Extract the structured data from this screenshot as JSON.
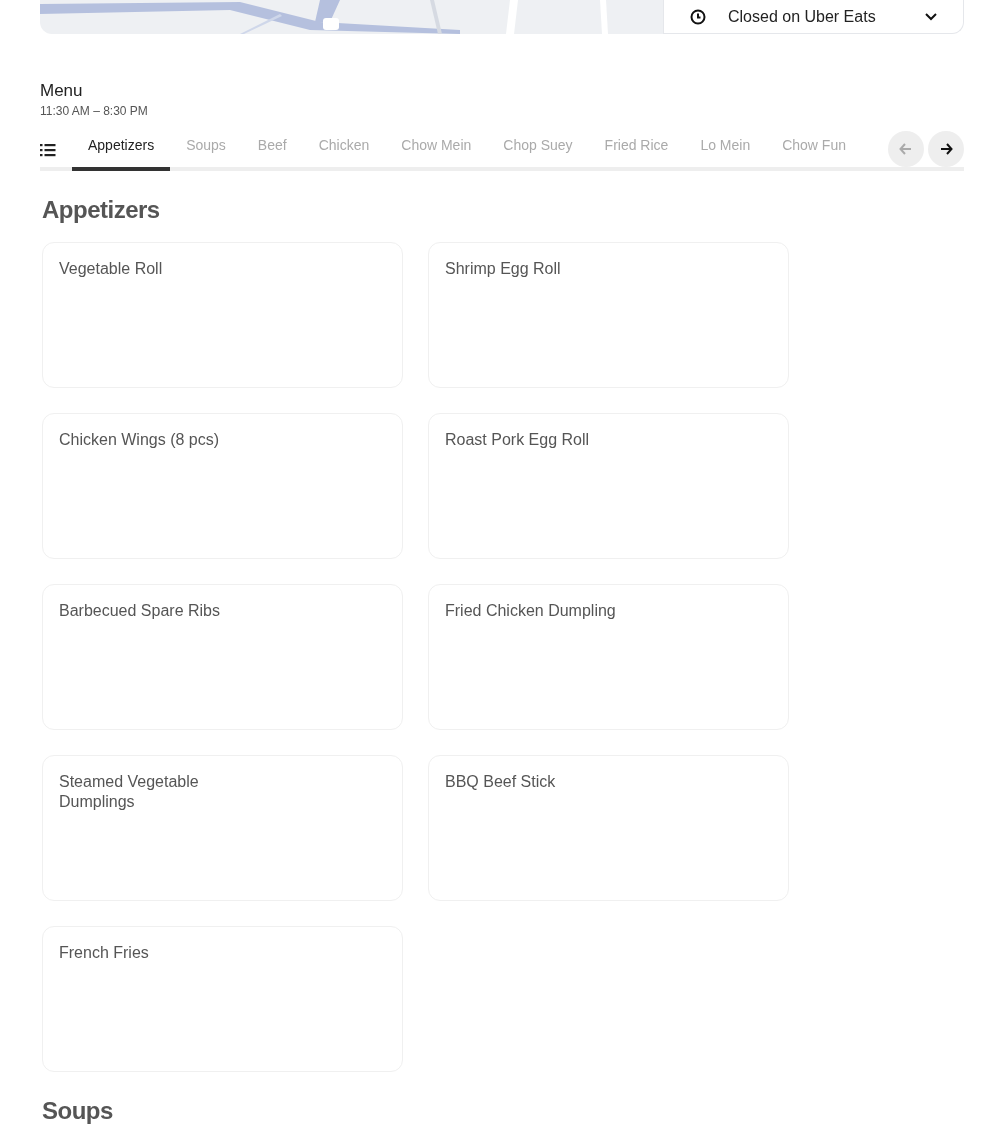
{
  "store_header": {
    "hours_dropdown": {
      "label": "Closed on Uber Eats"
    }
  },
  "menu": {
    "title": "Menu",
    "hours": "11:30 AM – 8:30 PM"
  },
  "category_tabs": [
    {
      "label": "Appetizers",
      "selected": true
    },
    {
      "label": "Soups",
      "selected": false
    },
    {
      "label": "Beef",
      "selected": false
    },
    {
      "label": "Chicken",
      "selected": false
    },
    {
      "label": "Chow Mein",
      "selected": false
    },
    {
      "label": "Chop Suey",
      "selected": false
    },
    {
      "label": "Fried Rice",
      "selected": false
    },
    {
      "label": "Lo Mein",
      "selected": false
    },
    {
      "label": "Chow Fun",
      "selected": false
    }
  ],
  "scroll_buttons": [
    {
      "kind": "back",
      "disabled": true
    },
    {
      "kind": "forward",
      "disabled": false
    }
  ],
  "sections": [
    {
      "title": "Appetizers",
      "items": [
        {
          "name": "Vegetable Roll"
        },
        {
          "name": "Shrimp Egg Roll"
        },
        {
          "name": "Chicken Wings (8 pcs)"
        },
        {
          "name": "Roast Pork Egg Roll"
        },
        {
          "name": "Barbecued Spare Ribs"
        },
        {
          "name": "Fried Chicken Dumpling"
        },
        {
          "name": "Steamed Vegetable Dumplings"
        },
        {
          "name": "BBQ Beef Stick"
        },
        {
          "name": "French Fries"
        }
      ]
    },
    {
      "title": "Soups"
    }
  ]
}
